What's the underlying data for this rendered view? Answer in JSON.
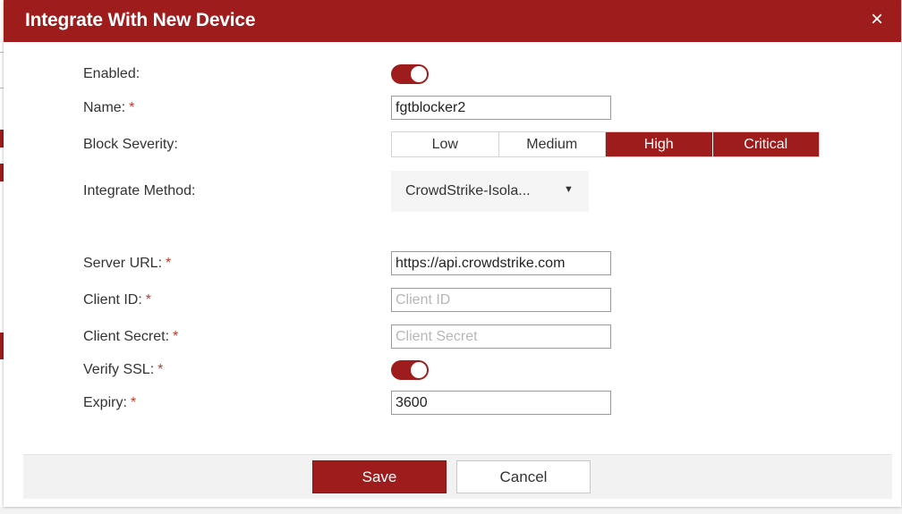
{
  "dialog": {
    "title": "Integrate With New Device",
    "close_glyph": "×"
  },
  "form": {
    "enabled": {
      "label": "Enabled:",
      "on": true
    },
    "name": {
      "label": "Name:",
      "required_mark": "*",
      "value": "fgtblocker2"
    },
    "block_severity": {
      "label": "Block Severity:",
      "options": [
        {
          "label": "Low",
          "selected": false
        },
        {
          "label": "Medium",
          "selected": false
        },
        {
          "label": "High",
          "selected": true
        },
        {
          "label": "Critical",
          "selected": true
        }
      ]
    },
    "integrate_method": {
      "label": "Integrate Method:",
      "value": "CrowdStrike-Isola...",
      "arrow_glyph": "▼"
    },
    "server_url": {
      "label": "Server URL:",
      "required_mark": "*",
      "value": "https://api.crowdstrike.com"
    },
    "client_id": {
      "label": "Client ID:",
      "required_mark": "*",
      "value": "",
      "placeholder": "Client ID"
    },
    "client_secret": {
      "label": "Client Secret:",
      "required_mark": "*",
      "value": "",
      "placeholder": "Client Secret"
    },
    "verify_ssl": {
      "label": "Verify SSL:",
      "required_mark": "*",
      "on": true
    },
    "expiry": {
      "label": "Expiry:",
      "required_mark": "*",
      "value": "3600"
    }
  },
  "footer": {
    "save_label": "Save",
    "cancel_label": "Cancel"
  },
  "colors": {
    "accent": "#9e1c1c",
    "required": "#c0392b",
    "footer_bg": "#f2f2f2",
    "select_bg": "#f5f5f5"
  }
}
